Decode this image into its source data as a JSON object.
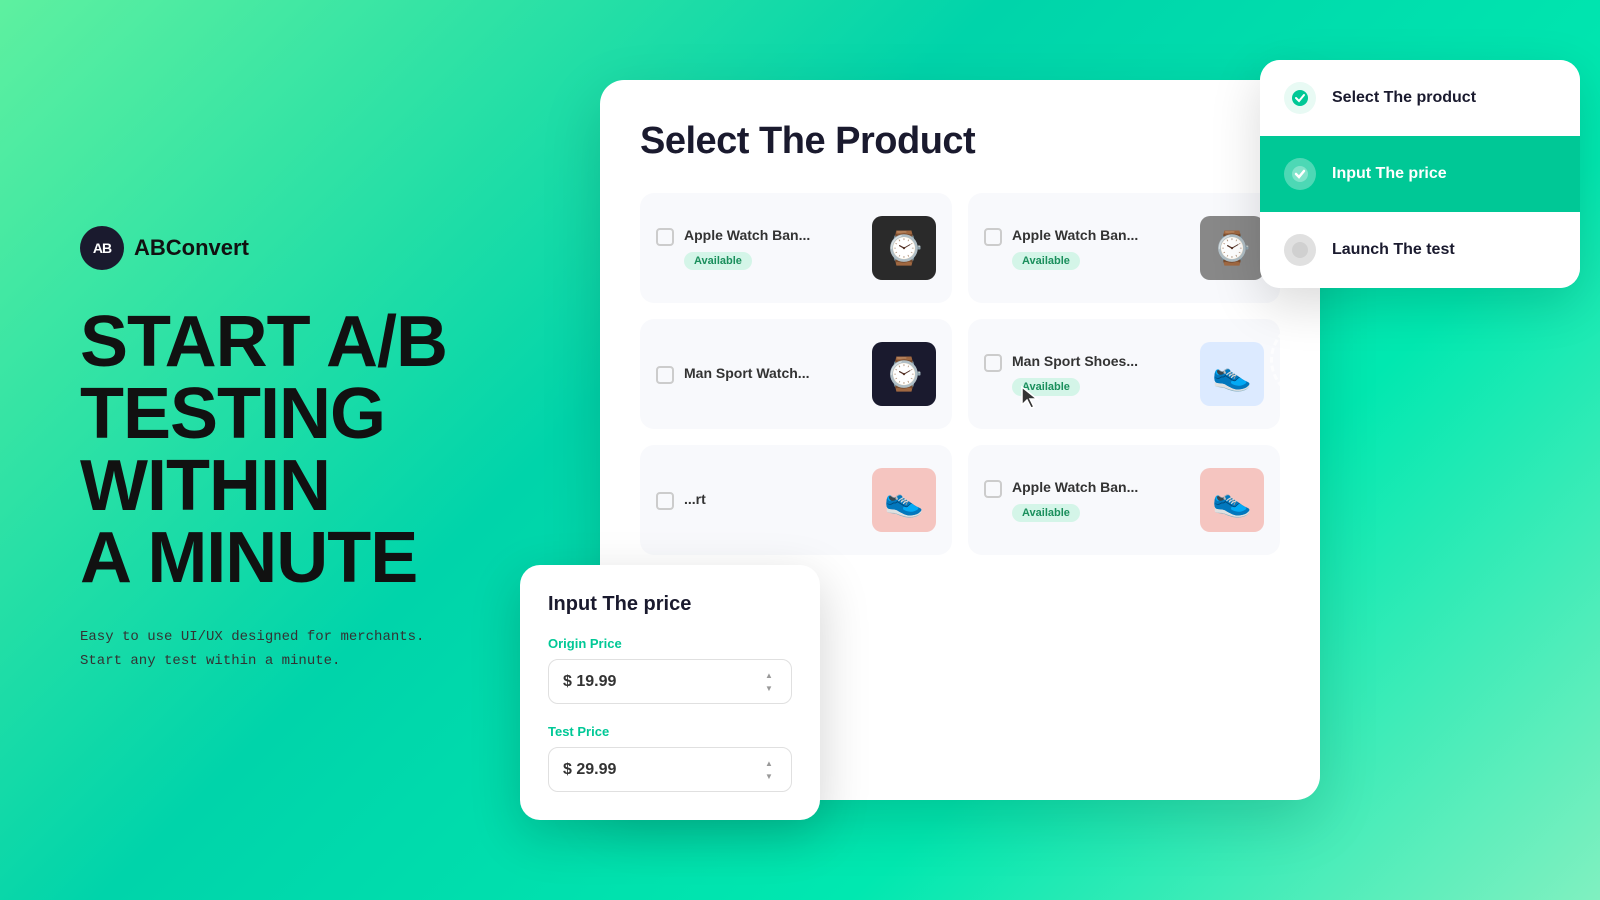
{
  "brand": {
    "logo_text": "ABConvert",
    "logo_initials": "AB"
  },
  "hero": {
    "headline_line1": "START A/B",
    "headline_line2": "TESTING",
    "headline_line3": "WITHIN",
    "headline_line4": "A MINUTE",
    "subtitle_line1": "Easy to use UI/UX designed for merchants.",
    "subtitle_line2": "Start any test within a minute."
  },
  "product_card": {
    "title": "Select The Product",
    "products": [
      {
        "name": "Apple Watch Ban...",
        "status": "Available",
        "emoji": "⌚",
        "bg": "#2a2a2a"
      },
      {
        "name": "Apple Watch Ban...",
        "status": "Available",
        "emoji": "⌚",
        "bg": "#555"
      },
      {
        "name": "Man Sport Watch...",
        "status": "",
        "emoji": "⌚",
        "bg": "#1a1a2e"
      },
      {
        "name": "Man Sport Shoes...",
        "status": "Available",
        "emoji": "👟",
        "bg": "#c8d8f8"
      },
      {
        "name": "...rt",
        "status": "",
        "emoji": "👟",
        "bg": "#f8c8c8"
      },
      {
        "name": "Apple Watch Ban...",
        "status": "Available",
        "emoji": "👟",
        "bg": "#f8c8c8"
      }
    ]
  },
  "steps": [
    {
      "label": "Select The product",
      "state": "completed"
    },
    {
      "label": "Input The price",
      "state": "active"
    },
    {
      "label": "Launch The test",
      "state": "pending"
    }
  ],
  "price_card": {
    "title": "Input The price",
    "origin_label": "Origin Price",
    "origin_value": "$ 19.99",
    "test_label": "Test Price",
    "test_value": "$ 29.99"
  }
}
